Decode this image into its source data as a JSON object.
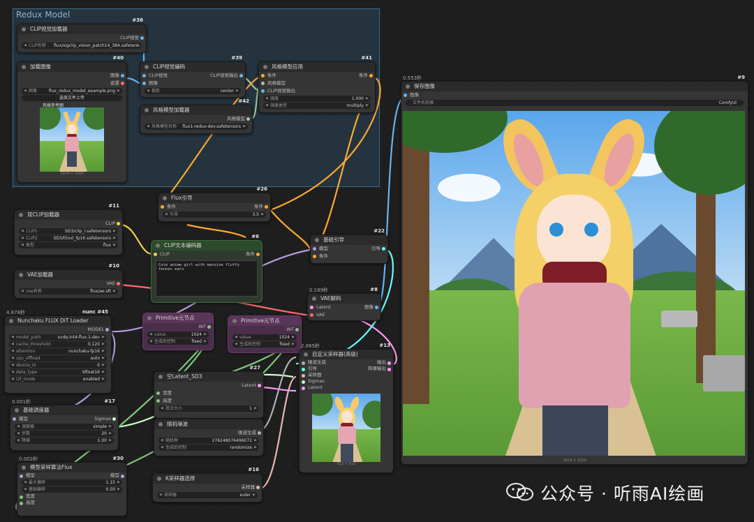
{
  "group": {
    "title": "Redux Model"
  },
  "n38": {
    "id": "#38",
    "title": "CLIP视觉加载器",
    "out": "CLIP视觉",
    "w_label": "CLIP名称",
    "w_value": "flux/sigclip_vision_patch14_384.safeten..."
  },
  "n40": {
    "id": "#40",
    "title": "加载图像",
    "out1": "图像",
    "out2": "遮罩",
    "w_label": "图像",
    "w_value": "flux_redux_model_example.png",
    "button": "选择文件上传",
    "preview_title": "风格参考图",
    "caption": "1024 × 1024"
  },
  "n39": {
    "id": "#39",
    "title": "CLIP视觉编码",
    "in1": "CLIP视觉",
    "in2": "图像",
    "out": "CLIP视觉输出",
    "w_label": "裁剪",
    "w_value": "center"
  },
  "n41": {
    "id": "#41",
    "title": "风格模型应用",
    "in1": "条件",
    "in2": "风格模型",
    "in3": "CLIP视觉输出",
    "out": "条件",
    "w1_label": "强度",
    "w1_value": "1.000",
    "w2_label": "强度类型",
    "w2_value": "multiply"
  },
  "n42": {
    "id": "#42",
    "title": "风格模型加载器",
    "out": "风格模型",
    "w_label": "风格模型名称",
    "w_value": "flux1-redux-dev.safetensors"
  },
  "n26": {
    "id": "#26",
    "title": "Flux引导",
    "in": "条件",
    "out": "条件",
    "w_label": "引导",
    "w_value": "3.5"
  },
  "n11": {
    "id": "#11",
    "title": "双CLIP加载器",
    "out": "CLIP",
    "w1_label": "CLIP1",
    "w1_value": "SD3/clip_l.safetensors",
    "w2_label": "CLIP2",
    "w2_value": "SD3/t5xxl_fp16.safetensors",
    "w3_label": "类型",
    "w3_value": "flux"
  },
  "n6": {
    "id": "#6",
    "title": "CLIP文本编码器",
    "in": "CLIP",
    "out": "条件",
    "text": "Cute anime girl with massive fluffy fennec ears"
  },
  "n10": {
    "id": "#10",
    "title": "VAE加载器",
    "out": "VAE",
    "w_label": "vae名称",
    "w_value": "flux/ae.sft"
  },
  "n22": {
    "id": "#22",
    "title": "基础引导",
    "in1": "模型",
    "in2": "条件",
    "out": "引导"
  },
  "n8": {
    "id": "#8",
    "time": "0.189秒",
    "title": "VAE解码",
    "in1": "Latent",
    "in2": "VAE",
    "out": "图像"
  },
  "n9": {
    "id": "#9",
    "time": "0.553秒",
    "title": "保存图像",
    "in": "图像",
    "w_label": "文件名前缀",
    "w_value": "ComfyUI",
    "caption": "1024 × 1024"
  },
  "n45": {
    "id": "nunc #45",
    "time": "4.878秒",
    "title": "Nunchaku FLUX DiT Loader",
    "out": "MODEL",
    "widgets": [
      {
        "label": "model_path",
        "value": "svdq-int4-flux.1-dev"
      },
      {
        "label": "cache_threshold",
        "value": "0.120"
      },
      {
        "label": "attention",
        "value": "nunchaku-fp16"
      },
      {
        "label": "cpu_offload",
        "value": "auto"
      },
      {
        "label": "device_id",
        "value": "0"
      },
      {
        "label": "data_type",
        "value": "bfloat16"
      },
      {
        "label": "i2f_mode",
        "value": "enabled"
      }
    ]
  },
  "p1": {
    "title": "Primitive元节点",
    "out": "INT",
    "w1_label": "value",
    "w1_value": "1024",
    "w2_label": "生成后控制",
    "w2_value": "fixed"
  },
  "p2": {
    "title": "Primitive元节点",
    "out": "INT",
    "w1_label": "value",
    "w1_value": "1024",
    "w2_label": "生成后控制",
    "w2_value": "fixed"
  },
  "n13": {
    "id": "#13",
    "time": "2.865秒",
    "title": "自定义采样器(高级)",
    "in1": "噪波生成",
    "in2": "引导",
    "in3": "采样器",
    "in4": "Sigmas",
    "in5": "Latent",
    "out1": "输出",
    "out2": "降噪输出",
    "caption": "512 × 512"
  },
  "n27": {
    "id": "#27",
    "title": "空Latent_SD3",
    "in1": "宽度",
    "in2": "高度",
    "out": "Latent",
    "w_label": "批次大小",
    "w_value": "1"
  },
  "n17": {
    "id": "#17",
    "time": "0.001秒",
    "title": "基础调度器",
    "in": "模型",
    "out": "Sigmas",
    "w1_label": "调度器",
    "w1_value": "simple",
    "w2_label": "步数",
    "w2_value": "20",
    "w3_label": "降噪",
    "w3_value": "1.00"
  },
  "n25": {
    "id": "#25",
    "title": "随机噪波",
    "out": "噪波生成",
    "w1_label": "随机种",
    "w1_value": "276248076496072",
    "w2_label": "生成后控制",
    "w2_value": "randomize"
  },
  "n30": {
    "id": "#30",
    "time": "0.002秒",
    "title": "模型采样算法Flux",
    "in1": "模型",
    "in2": "宽度",
    "in3": "高度",
    "out": "模型",
    "w1_label": "最大偏移",
    "w1_value": "1.15",
    "w2_label": "基础偏移",
    "w2_value": "0.50"
  },
  "n16": {
    "id": "#16",
    "title": "K采样器选择",
    "out": "采样器",
    "w_label": "采样器",
    "w_value": "euler"
  },
  "watermark": {
    "text": "公众号 · 听雨AI绘画"
  }
}
